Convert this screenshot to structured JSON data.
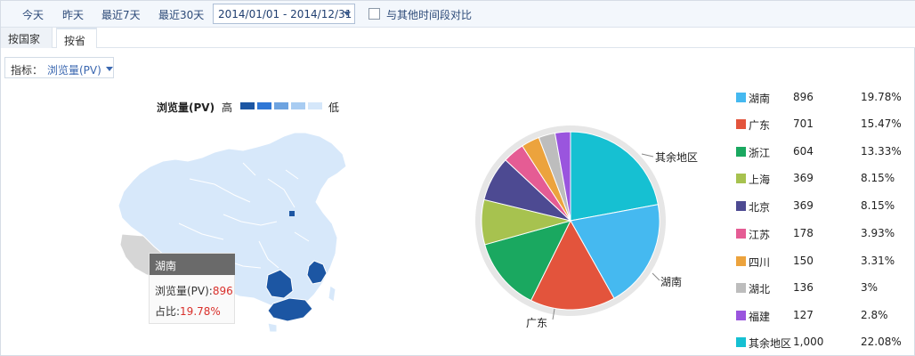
{
  "toolbar": {
    "today": "今天",
    "yesterday": "昨天",
    "last7": "最近7天",
    "last30": "最近30天",
    "date_range": "2014/01/01 - 2014/12/31",
    "compare_label": "与其他时间段对比"
  },
  "tabs": [
    {
      "label": "按国家"
    },
    {
      "label": "按省"
    }
  ],
  "metric": {
    "label": "指标：",
    "value": "浏览量(PV)"
  },
  "map_legend": {
    "title": "浏览量(PV)",
    "high": "高",
    "low": "低",
    "colors": [
      "#1c56a3",
      "#2f77d6",
      "#6da3e0",
      "#a8ccf2",
      "#d5e7fa"
    ]
  },
  "tooltip": {
    "region": "湖南",
    "pv_label": "浏览量(PV):",
    "pv_value": "896",
    "share_label": "占比:",
    "share_value": "19.78%"
  },
  "pie_labels": {
    "rest": "其余地区",
    "hunan": "湖南",
    "guangdong": "广东"
  },
  "legend": [
    {
      "name": "湖南",
      "count": "896",
      "pct": "19.78%",
      "color": "#45b9f0"
    },
    {
      "name": "广东",
      "count": "701",
      "pct": "15.47%",
      "color": "#e3543c"
    },
    {
      "name": "浙江",
      "count": "604",
      "pct": "13.33%",
      "color": "#1aa860"
    },
    {
      "name": "上海",
      "count": "369",
      "pct": "8.15%",
      "color": "#a7c24f"
    },
    {
      "name": "北京",
      "count": "369",
      "pct": "8.15%",
      "color": "#4d4a92"
    },
    {
      "name": "江苏",
      "count": "178",
      "pct": "3.93%",
      "color": "#e55c94"
    },
    {
      "name": "四川",
      "count": "150",
      "pct": "3.31%",
      "color": "#eca33d"
    },
    {
      "name": "湖北",
      "count": "136",
      "pct": "3%",
      "color": "#bdbdbd"
    },
    {
      "name": "福建",
      "count": "127",
      "pct": "2.8%",
      "color": "#9a55de"
    },
    {
      "name": "其余地区",
      "count": "1,000",
      "pct": "22.08%",
      "color": "#16c0d2"
    }
  ],
  "chart_data": {
    "type": "pie",
    "categories": [
      "湖南",
      "广东",
      "浙江",
      "上海",
      "北京",
      "江苏",
      "四川",
      "湖北",
      "福建",
      "其余地区"
    ],
    "values": [
      896,
      701,
      604,
      369,
      369,
      178,
      150,
      136,
      127,
      1000
    ],
    "percent": [
      19.78,
      15.47,
      13.33,
      8.15,
      8.15,
      3.93,
      3.31,
      3,
      2.8,
      22.08
    ],
    "legend": "right"
  }
}
